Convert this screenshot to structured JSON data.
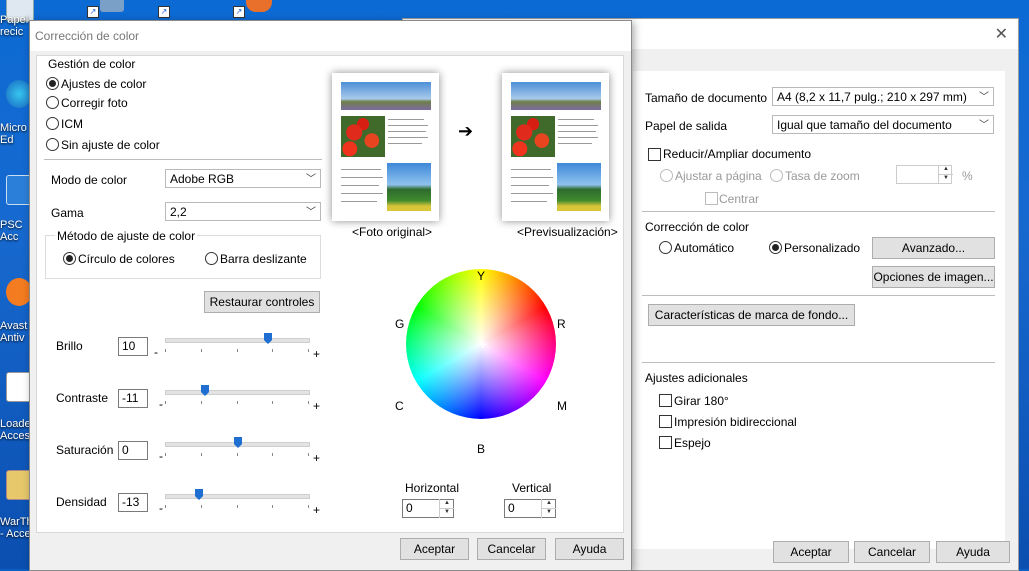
{
  "desktop": {
    "icons": [
      {
        "label": "Papel\nrecic"
      },
      {
        "label": "Micro\nEd"
      },
      {
        "label": "PSC\nAcc"
      },
      {
        "label": "Avast\nAntiv"
      },
      {
        "label": "Loader\nAcces"
      },
      {
        "label": "WarTh\n- Acce"
      }
    ]
  },
  "bg_dialog": {
    "doc_size_label": "Tamaño de documento",
    "doc_size_value": "A4 (8,2 x 11,7 pulg.; 210 x 297 mm)",
    "output_paper_label": "Papel de salida",
    "output_paper_value": "Igual que tamaño del documento",
    "reduce_label": "Reducir/Ampliar documento",
    "fit_page_label": "Ajustar a página",
    "zoom_rate_label": "Tasa de zoom",
    "percent": "%",
    "center_label": "Centrar",
    "color_correction_label": "Corrección de color",
    "auto_label": "Automático",
    "custom_label": "Personalizado",
    "advanced_button": "Avanzado...",
    "image_options_button": "Opciones de imagen...",
    "watermark_button": "Características de marca de fondo...",
    "additional_label": "Ajustes adicionales",
    "rotate_label": "Girar 180°",
    "bidirectional_label": "Impresión bidireccional",
    "mirror_label": "Espejo",
    "ok": "Aceptar",
    "cancel": "Cancelar",
    "help": "Ayuda",
    "close_glyph": "✕"
  },
  "fg_dialog": {
    "title": "Corrección de color",
    "color_mgmt_label": "Gestión de color",
    "options": [
      "Ajustes de color",
      "Corregir foto",
      "ICM",
      "Sin ajuste de color"
    ],
    "selected_option": "Ajustes de color",
    "color_mode_label": "Modo de color",
    "color_mode_value": "Adobe RGB",
    "gamma_label": "Gama",
    "gamma_value": "2,2",
    "adjust_method_label": "Método de ajuste de color",
    "circle_label": "Círculo de colores",
    "slider_label": "Barra deslizante",
    "restore_button": "Restaurar controles",
    "sliders": [
      {
        "label": "Brillo",
        "value": "10",
        "level": 0.72
      },
      {
        "label": "Contraste",
        "value": "-11",
        "level": 0.26
      },
      {
        "label": "Saturación",
        "value": "0",
        "level": 0.5
      },
      {
        "label": "Densidad",
        "value": "-13",
        "level": 0.22
      }
    ],
    "minus": "-",
    "plus": "+",
    "original_caption": "<Foto original>",
    "preview_caption": "<Previsualización>",
    "arrow_glyph": "➔",
    "wheel_labels": {
      "Y": "Y",
      "R": "R",
      "M": "M",
      "B": "B",
      "C": "C",
      "G": "G"
    },
    "horizontal_label": "Horizontal",
    "horizontal_value": "0",
    "vertical_label": "Vertical",
    "vertical_value": "0",
    "ok": "Aceptar",
    "cancel": "Cancelar",
    "help": "Ayuda"
  }
}
